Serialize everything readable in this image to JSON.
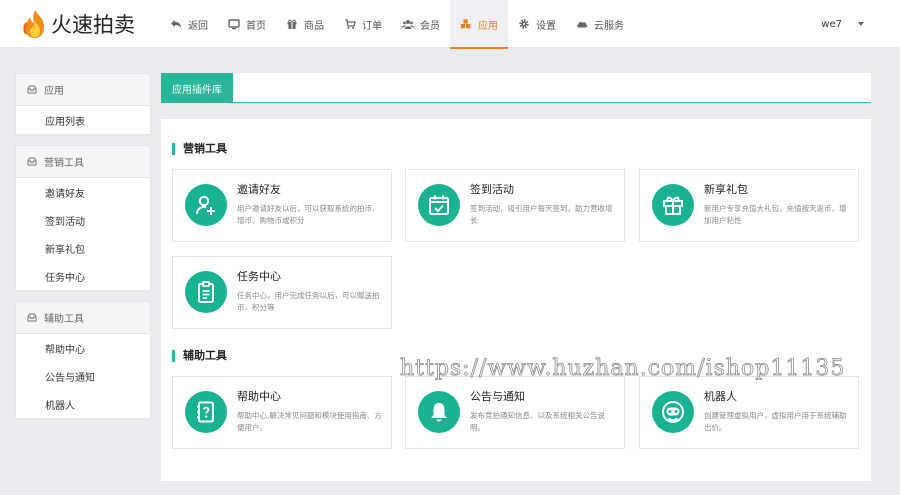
{
  "brand": {
    "name": "火速拍卖"
  },
  "nav": {
    "items": [
      {
        "label": "返回",
        "icon": "back-icon"
      },
      {
        "label": "首页",
        "icon": "monitor-icon"
      },
      {
        "label": "商品",
        "icon": "gift-icon"
      },
      {
        "label": "订单",
        "icon": "cart-icon"
      },
      {
        "label": "会员",
        "icon": "users-icon"
      },
      {
        "label": "应用",
        "icon": "cubes-icon",
        "active": true
      },
      {
        "label": "设置",
        "icon": "gear-icon"
      },
      {
        "label": "云服务",
        "icon": "cloud-icon"
      }
    ],
    "user": "we7"
  },
  "sidebar": {
    "groups": [
      {
        "title": "应用",
        "items": [
          "应用列表"
        ]
      },
      {
        "title": "营销工具",
        "items": [
          "邀请好友",
          "签到活动",
          "新享礼包",
          "任务中心"
        ]
      },
      {
        "title": "辅助工具",
        "items": [
          "帮助中心",
          "公告与通知",
          "机器人"
        ]
      }
    ]
  },
  "main": {
    "tab": "应用插件库",
    "sections": [
      {
        "title": "营销工具",
        "cards": [
          {
            "title": "邀请好友",
            "desc": "用户邀请好友以后，可以获取系统的拍币、增币、购物币或积分",
            "icon": "user-plus-icon"
          },
          {
            "title": "签到活动",
            "desc": "签到活动，吸引用户每天签到，助力营收增长",
            "icon": "calendar-check-icon"
          },
          {
            "title": "新享礼包",
            "desc": "新用户专享充值大礼包，充值按天返币，增加用户粘性",
            "icon": "gift-box-icon"
          },
          {
            "title": "任务中心",
            "desc": "任务中心，用户完成任务以后，可以赠送拍币、积分等",
            "icon": "clipboard-icon"
          }
        ]
      },
      {
        "title": "辅助工具",
        "cards": [
          {
            "title": "帮助中心",
            "desc": "帮助中心,解决常见问题和模块使用指南、方便用户。",
            "icon": "help-book-icon"
          },
          {
            "title": "公告与通知",
            "desc": "发布竞拍通知信息、以及系统相关公告说明。",
            "icon": "bell-icon"
          },
          {
            "title": "机器人",
            "desc": "创建管理虚拟用户，虚拟用户用于系统辅助出价。",
            "icon": "robot-icon"
          }
        ]
      }
    ]
  },
  "watermark": "https://www.huzhan.com/ishop11135",
  "colors": {
    "accent": "#19b394",
    "nav_active": "#f0801f"
  }
}
